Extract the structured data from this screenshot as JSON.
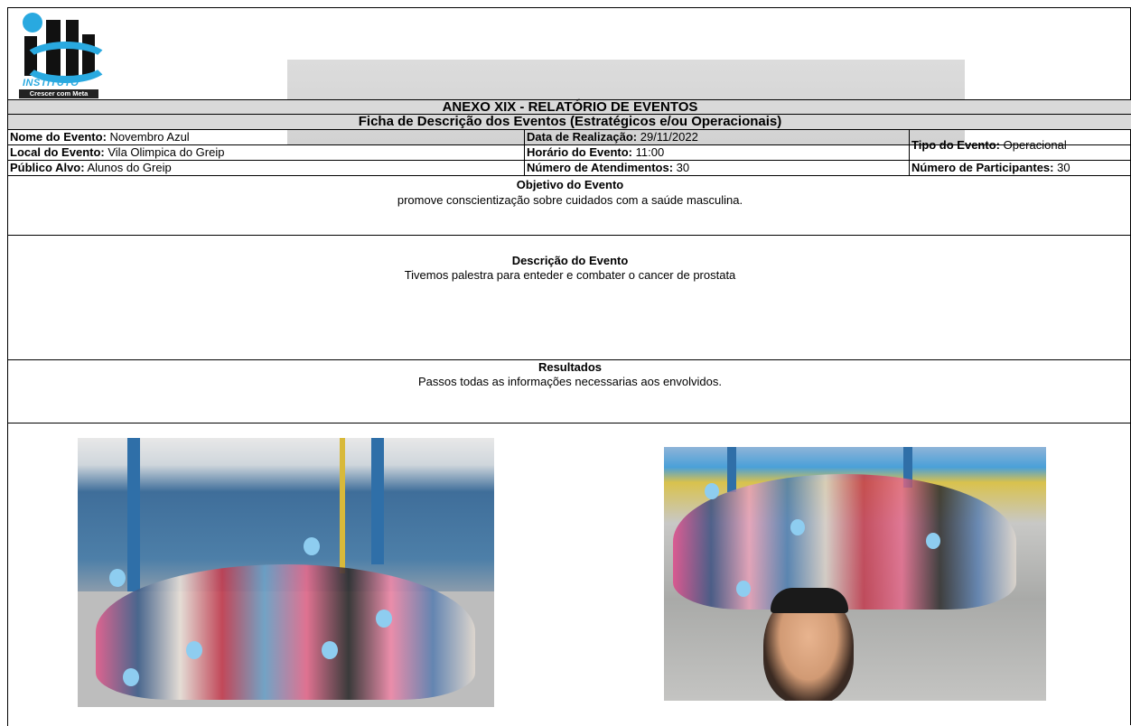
{
  "logo": {
    "name": "INSTITUTO",
    "tagline": "Crescer com Meta"
  },
  "header": {
    "title": "ANEXO XIX - RELATÓRIO DE EVENTOS",
    "subtitle": "Ficha de Descrição dos Eventos (Estratégicos e/ou Operacionais)"
  },
  "fields": {
    "nome_label": "Nome do Evento:",
    "nome_value": "Novembro Azul",
    "data_label": "Data de Realização:",
    "data_value": "29/11/2022",
    "tipo_label": "Tipo do Evento:",
    "tipo_value": "Operacional",
    "local_label": "Local do Evento:",
    "local_value": "Vila Olimpica do Greip",
    "horario_label": "Horário do Evento:",
    "horario_value": "11:00",
    "publico_label": "Público Alvo:",
    "publico_value": "Alunos do Greip",
    "atendimentos_label": "Número de Atendimentos:",
    "atendimentos_value": "30",
    "participantes_label": "Número de Participantes:",
    "participantes_value": "30"
  },
  "objetivo": {
    "heading": "Objetivo do Evento",
    "text": "promove conscientização sobre cuidados com a saúde masculina."
  },
  "descricao": {
    "heading": "Descrição do Evento",
    "text": "Tivemos palestra para enteder e combater o cancer de prostata"
  },
  "resultados": {
    "heading": "Resultados",
    "text": "Passos todas as informações necessarias aos envolvidos."
  },
  "colors": {
    "header_grey": "#d9d9d9",
    "logo_blue": "#29a9e0"
  }
}
